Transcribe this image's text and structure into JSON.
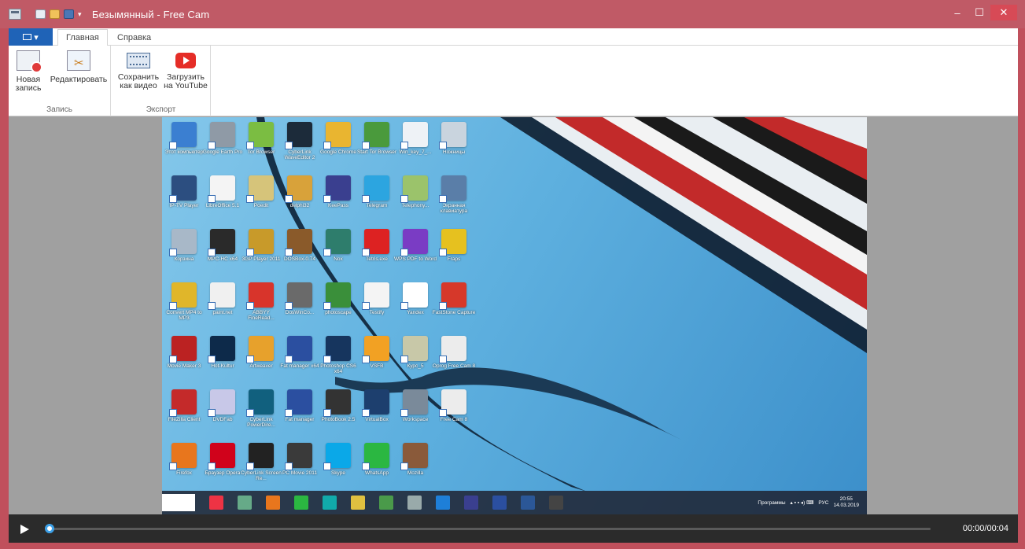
{
  "window": {
    "title": "Безымянный - Free Cam",
    "controls": {
      "minimize": "–",
      "maximize": "☐",
      "close": "✕"
    }
  },
  "ribbon": {
    "file_tab_icon": "menu-icon",
    "tabs": [
      {
        "label": "Главная",
        "active": true
      },
      {
        "label": "Справка",
        "active": false
      }
    ],
    "groups": [
      {
        "label": "Запись",
        "buttons": [
          {
            "label": "Новая\nзапись",
            "icon": "new-recording-icon"
          },
          {
            "label": "Редактировать",
            "icon": "edit-icon"
          }
        ]
      },
      {
        "label": "Экспорт",
        "buttons": [
          {
            "label": "Сохранить\nкак видео",
            "icon": "save-video-icon"
          },
          {
            "label": "Загрузить\nна YouTube",
            "icon": "youtube-icon"
          }
        ]
      }
    ]
  },
  "desktop_icons": [
    {
      "label": "Этот компьютер",
      "color": "#3b7fd1"
    },
    {
      "label": "Google Earth Pro",
      "color": "#8f9aa6"
    },
    {
      "label": "Tor Browser",
      "color": "#7bbd42"
    },
    {
      "label": "CyberLink WaveEditor 2",
      "color": "#1c2b3a"
    },
    {
      "label": "Google Chrome",
      "color": "#e9b530"
    },
    {
      "label": "Start Tor Browser",
      "color": "#4a9a3c"
    },
    {
      "label": "Win_key_7_...",
      "color": "#eef2f6"
    },
    {
      "label": "Ножницы",
      "color": "#c9d4de"
    },
    {
      "label": "IP-TV Player",
      "color": "#2c4e80"
    },
    {
      "label": "LibreOffice 5.1",
      "color": "#f4f4f4"
    },
    {
      "label": "Poedit",
      "color": "#d6c47a"
    },
    {
      "label": "delphi32",
      "color": "#d8a23a"
    },
    {
      "label": "KeePass",
      "color": "#3a3f8f"
    },
    {
      "label": "Telegram",
      "color": "#2ca5e0"
    },
    {
      "label": "Telephony...",
      "color": "#9bc36b"
    },
    {
      "label": "Экранная клавиатура",
      "color": "#5a7ea8"
    },
    {
      "label": "Корзина",
      "color": "#a8b8c8"
    },
    {
      "label": "MPC-HC x64",
      "color": "#2a2a2a"
    },
    {
      "label": "3GP Player 2011",
      "color": "#c89a2a"
    },
    {
      "label": "DOSBox-0.74",
      "color": "#8a5a2a"
    },
    {
      "label": "Nox",
      "color": "#2e7d6c"
    },
    {
      "label": "Tetris.exe",
      "color": "#d22"
    },
    {
      "label": "WPS PDF to Word",
      "color": "#7a3cc4"
    },
    {
      "label": "Fraps",
      "color": "#e6c11f"
    },
    {
      "label": "Convert MP4 to MP3",
      "color": "#e0b62a"
    },
    {
      "label": "paint.net",
      "color": "#f0f0f0"
    },
    {
      "label": "ABBYY FineRead...",
      "color": "#d8342b"
    },
    {
      "label": "DosWinCo...",
      "color": "#6a6a6a"
    },
    {
      "label": "photoscape",
      "color": "#3a8f3a"
    },
    {
      "label": "Testify",
      "color": "#f4f4f4"
    },
    {
      "label": "Yandex",
      "color": "#fff"
    },
    {
      "label": "FastStone Capture",
      "color": "#d6382a"
    },
    {
      "label": "Movie Maker 3",
      "color": "#b22"
    },
    {
      "label": "Hot-Kultur",
      "color": "#0d2a4a"
    },
    {
      "label": "Artweaver",
      "color": "#e7a12c"
    },
    {
      "label": "Fat manager x64",
      "color": "#2b4fa0"
    },
    {
      "label": "Photoshop CS6 x64",
      "color": "#16355e"
    },
    {
      "label": "VSFB",
      "color": "#f2a123"
    },
    {
      "label": "Курс_5",
      "color": "#c8c8a8"
    },
    {
      "label": "Oprog Free Cam 8",
      "color": "#ececec"
    },
    {
      "label": "FileZilla Client",
      "color": "#c42a2a"
    },
    {
      "label": "DVDFab",
      "color": "#c8c8e8"
    },
    {
      "label": "CyberLink PowerDire...",
      "color": "#11607e"
    },
    {
      "label": "Fat manager",
      "color": "#2b4fa0"
    },
    {
      "label": "PhotoBook 2.5",
      "color": "#333"
    },
    {
      "label": "VirtualBox",
      "color": "#1d3f6e"
    },
    {
      "label": "Workspace",
      "color": "#7a8a9a"
    },
    {
      "label": "Free Cam 8",
      "color": "#ececec"
    },
    {
      "label": "Firefox",
      "color": "#e8761d"
    },
    {
      "label": "Браузер Opera",
      "color": "#d0021b"
    },
    {
      "label": "CyberLink Screen Re...",
      "color": "#222"
    },
    {
      "label": "PC Movie 2011",
      "color": "#3a3a3a"
    },
    {
      "label": "Skype",
      "color": "#0aa8e8"
    },
    {
      "label": "WhatsApp",
      "color": "#2bb741"
    },
    {
      "label": "Mozilla",
      "color": "#8a5a3a"
    }
  ],
  "desktop_taskbar": {
    "items": [
      "#e34",
      "#6a8",
      "#e8761d",
      "#2bb741",
      "#1aa",
      "#e0c040",
      "#4a9a4a",
      "#9aa",
      "#1e7fd8",
      "#3a3f8f",
      "#2b4fa0",
      "#2b5797",
      "#444"
    ],
    "tray_label": "Программы",
    "lang": "РУС",
    "time": "20:55",
    "date": "14.03.2019"
  },
  "player": {
    "time_display": "00:00/00:04",
    "progress": 0
  }
}
